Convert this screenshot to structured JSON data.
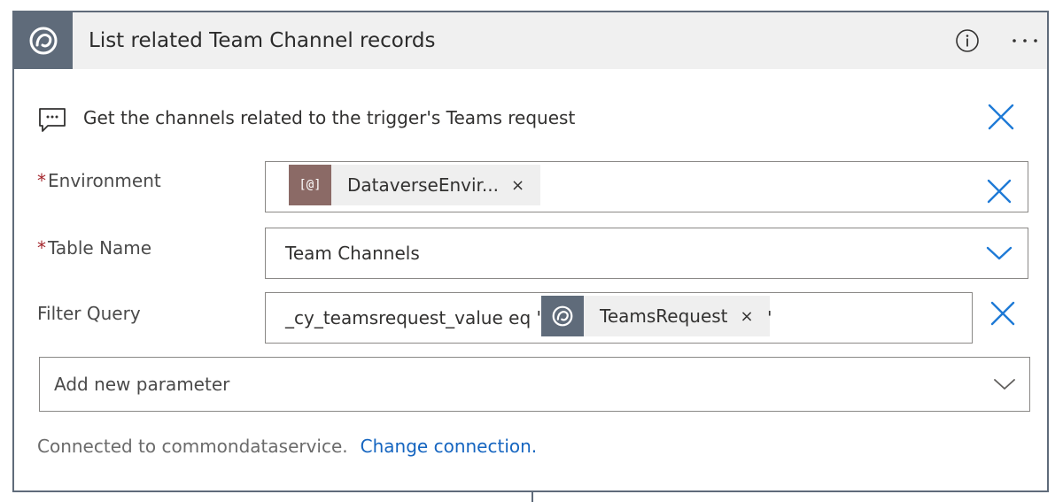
{
  "card": {
    "title": "List related Team Channel records",
    "comment": "Get the channels related to the trigger's Teams request"
  },
  "environment": {
    "label": "Environment",
    "required_mark": "*",
    "token_label": "DataverseEnvir...",
    "token_icon_text": "[@]",
    "token_color": "#8b6a66"
  },
  "table_name": {
    "label": "Table Name",
    "required_mark": "*",
    "value": "Team Channels"
  },
  "filter_query": {
    "label": "Filter Query",
    "prefix_text": "_cy_teamsrequest_value eq '",
    "token_label": "TeamsRequest",
    "suffix_text": "'"
  },
  "add_parameter": {
    "label": "Add new parameter"
  },
  "connection": {
    "text": "Connected to commondataservice.",
    "link": "Change connection."
  },
  "token_remove_glyph": "×",
  "colors": {
    "header_bg": "#f0f0f0",
    "brand": "#5f6b7a",
    "accent": "#1e7ad6",
    "required": "#a4262c",
    "link": "#1565c0"
  }
}
